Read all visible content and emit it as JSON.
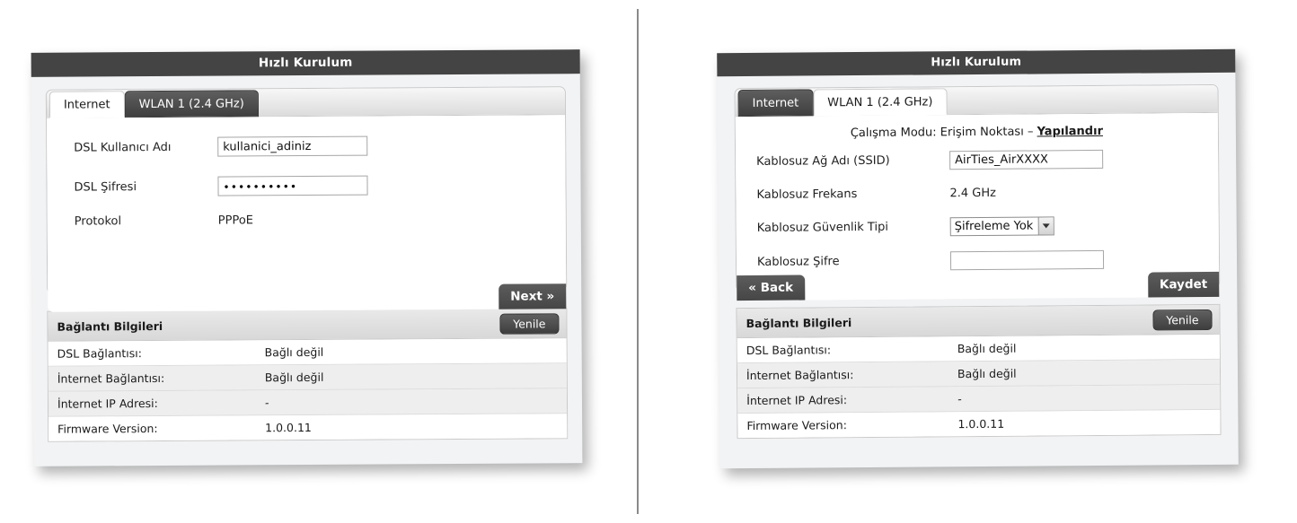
{
  "divider": {
    "present": true
  },
  "panels": [
    {
      "id": "left",
      "header_title": "Hızlı Kurulum",
      "tabs": [
        {
          "label": "Internet",
          "active": true
        },
        {
          "label": "WLAN 1 (2.4 GHz)",
          "active": false
        }
      ],
      "form": {
        "username_label": "DSL Kullanıcı Adı",
        "username_value": "kullanici_adiniz",
        "password_label": "DSL Şifresi",
        "password_value": "••••••••••",
        "protocol_label": "Protokol",
        "protocol_value": "PPPoE"
      },
      "buttons": {
        "next_label": "Next »"
      },
      "info": {
        "title": "Bağlantı Bilgileri",
        "refresh_label": "Yenile",
        "rows": [
          {
            "key": "DSL Bağlantısı:",
            "value": "Bağlı değil"
          },
          {
            "key": "İnternet Bağlantısı:",
            "value": "Bağlı değil"
          },
          {
            "key": "İnternet IP Adresi:",
            "value": "-"
          },
          {
            "key": "Firmware Version:",
            "value": "1.0.0.11"
          }
        ]
      }
    },
    {
      "id": "right",
      "header_title": "Hızlı Kurulum",
      "tabs": [
        {
          "label": "Internet",
          "active": false
        },
        {
          "label": "WLAN 1 (2.4 GHz)",
          "active": true
        }
      ],
      "form": {
        "mode_prefix": "Çalışma Modu: Erişim Noktası – ",
        "mode_link": "Yapılandır",
        "ssid_label": "Kablosuz Ağ Adı (SSID)",
        "ssid_value": "AirTies_AirXXXX",
        "freq_label": "Kablosuz Frekans",
        "freq_value": "2.4 GHz",
        "security_label": "Kablosuz Güvenlik Tipi",
        "security_value": "Şifreleme Yok",
        "wpassword_label": "Kablosuz Şifre",
        "wpassword_value": ""
      },
      "buttons": {
        "back_label": "« Back",
        "save_label": "Kaydet"
      },
      "info": {
        "title": "Bağlantı Bilgileri",
        "refresh_label": "Yenile",
        "rows": [
          {
            "key": "DSL Bağlantısı:",
            "value": "Bağlı değil"
          },
          {
            "key": "İnternet Bağlantısı:",
            "value": "Bağlı değil"
          },
          {
            "key": "İnternet IP Adresi:",
            "value": "-"
          },
          {
            "key": "Firmware Version:",
            "value": "1.0.0.11"
          }
        ]
      }
    }
  ],
  "colors": {
    "header_bar": "#444444",
    "card_bg": "#f2f3f5",
    "tab_inactive": "#4a4a4a",
    "button_dark": "#4d4d4d",
    "page_bg": "#ffffff"
  }
}
